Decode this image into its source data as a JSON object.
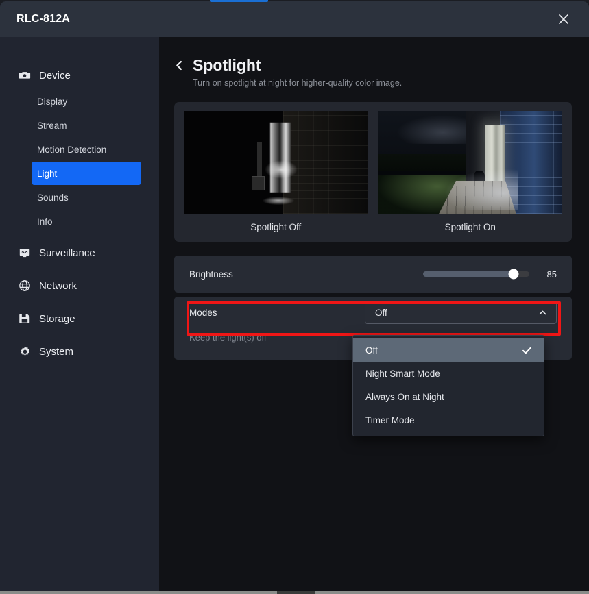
{
  "window": {
    "title": "RLC-812A",
    "close_icon": "close-icon"
  },
  "sidebar": {
    "groups": [
      {
        "label": "Device",
        "icon": "camera-icon",
        "items": [
          {
            "label": "Display",
            "active": false
          },
          {
            "label": "Stream",
            "active": false
          },
          {
            "label": "Motion Detection",
            "active": false
          },
          {
            "label": "Light",
            "active": true
          },
          {
            "label": "Sounds",
            "active": false
          },
          {
            "label": "Info",
            "active": false
          }
        ]
      },
      {
        "label": "Surveillance",
        "icon": "monitor-icon",
        "items": []
      },
      {
        "label": "Network",
        "icon": "globe-icon",
        "items": []
      },
      {
        "label": "Storage",
        "icon": "floppy-disk-icon",
        "items": []
      },
      {
        "label": "System",
        "icon": "gear-icon",
        "items": []
      }
    ]
  },
  "page": {
    "back_icon": "chevron-left-icon",
    "title": "Spotlight",
    "subtitle": "Turn on spotlight at night for higher-quality color image."
  },
  "preview": {
    "thumbnails": [
      {
        "caption": "Spotlight Off"
      },
      {
        "caption": "Spotlight On"
      }
    ]
  },
  "brightness": {
    "label": "Brightness",
    "value": "85",
    "percent": 85
  },
  "modes": {
    "label": "Modes",
    "selected": "Off",
    "caret_icon": "chevron-up-icon",
    "description": "Keep the light(s) off",
    "options": [
      {
        "label": "Off",
        "selected": true
      },
      {
        "label": "Night Smart Mode",
        "selected": false
      },
      {
        "label": "Always On at Night",
        "selected": false
      },
      {
        "label": "Timer Mode",
        "selected": false
      }
    ]
  },
  "colors": {
    "accent_blue": "#1368f5",
    "annotation_red": "#f01616",
    "titlebar": "#2c323d",
    "sidebar": "#212530",
    "card": "#24272f",
    "row": "#272b34"
  }
}
